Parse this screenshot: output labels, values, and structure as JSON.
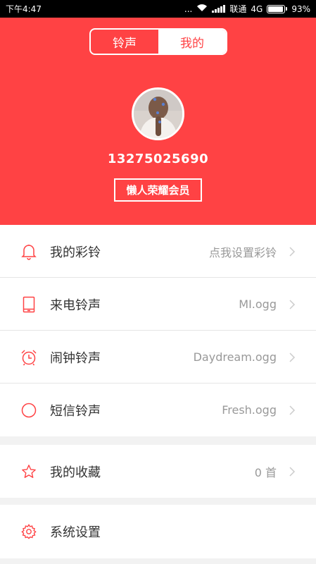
{
  "status_bar": {
    "time": "下午4:47",
    "dots": "...",
    "carrier": "联通",
    "network": "4G",
    "battery": "93%",
    "battery_level": 0.93
  },
  "tabs": [
    {
      "label": "铃声",
      "selected": false
    },
    {
      "label": "我的",
      "selected": true
    }
  ],
  "profile": {
    "phone": "13275025690",
    "membership": "懒人荣耀会员"
  },
  "colors": {
    "accent": "#ff4244",
    "arrow": "#cccccc"
  },
  "menu": [
    {
      "label": "我的彩铃",
      "value": "点我设置彩铃",
      "icon": "bell-icon"
    },
    {
      "label": "来电铃声",
      "value": "MI.ogg",
      "icon": "phone-icon"
    },
    {
      "label": "闹钟铃声",
      "value": "Daydream.ogg",
      "icon": "alarm-clock-icon"
    },
    {
      "label": "短信铃声",
      "value": "Fresh.ogg",
      "icon": "message-circle-icon"
    },
    {
      "label": "我的收藏",
      "value": "0 首",
      "icon": "star-icon"
    },
    {
      "label": "系统设置",
      "value": "",
      "icon": "gear-icon"
    }
  ]
}
